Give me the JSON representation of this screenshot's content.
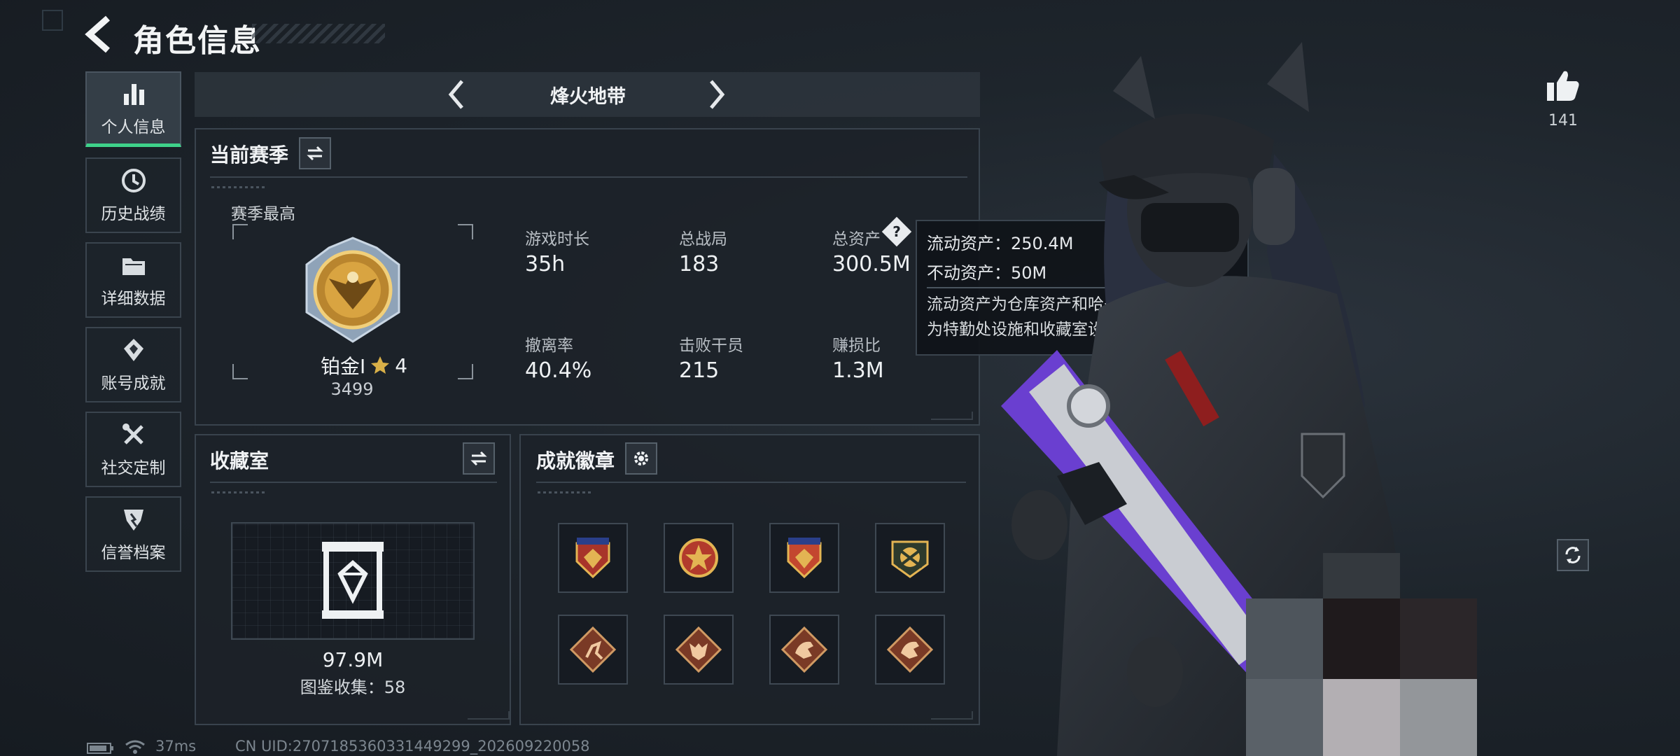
{
  "header": {
    "title": "角色信息"
  },
  "sidebar": {
    "items": [
      {
        "label": "个人信息",
        "icon": "bar-chart-icon",
        "active": true
      },
      {
        "label": "历史战绩",
        "icon": "history-clock-icon",
        "active": false
      },
      {
        "label": "详细数据",
        "icon": "folder-icon",
        "active": false
      },
      {
        "label": "账号成就",
        "icon": "achievement-icon",
        "active": false
      },
      {
        "label": "社交定制",
        "icon": "wrench-tools-icon",
        "active": false
      },
      {
        "label": "信誉档案",
        "icon": "shield-badge-icon",
        "active": false
      }
    ]
  },
  "mode_selector": {
    "title": "烽火地带"
  },
  "season": {
    "title": "当前赛季",
    "best_label": "赛季最高",
    "rank_name": "铂金I",
    "rank_stars": "4",
    "rank_score": "3499",
    "stats": [
      {
        "label": "游戏时长",
        "value": "35h"
      },
      {
        "label": "总战局",
        "value": "183"
      },
      {
        "label": "总资产",
        "value": "300.5M"
      },
      {
        "label": "撤离率",
        "value": "40.4%"
      },
      {
        "label": "击败干员",
        "value": "215"
      },
      {
        "label": "赚损比",
        "value": "1.3M"
      }
    ]
  },
  "tooltip": {
    "liquid": "流动资产：250.4M",
    "fixed": "不动资产：50M",
    "desc_line1": "流动资产为仓库资产和哈夫币，不动资产",
    "desc_line2": "为特勤处设施和收藏室设施"
  },
  "collection": {
    "title": "收藏室",
    "value": "97.9M",
    "collected": "图鉴收集：58"
  },
  "badges": {
    "title": "成就徽章",
    "items": [
      {
        "icon": "badge-shield-stars-icon"
      },
      {
        "icon": "badge-star-wings-icon"
      },
      {
        "icon": "badge-shield-stars-icon"
      },
      {
        "icon": "badge-crossed-guns-icon"
      },
      {
        "icon": "badge-diamond-runner-icon"
      },
      {
        "icon": "badge-diamond-wolf-icon"
      },
      {
        "icon": "badge-diamond-dragon-icon"
      },
      {
        "icon": "badge-diamond-dragon-icon"
      }
    ]
  },
  "likes": {
    "count": "141"
  },
  "status_bar": {
    "ping": "37ms",
    "uid": "CN UID:2707185360331449299_202609220058"
  },
  "colors": {
    "accent_green": "#3ed28a",
    "gold": "#d9a441",
    "purple": "#6a3fd0"
  }
}
